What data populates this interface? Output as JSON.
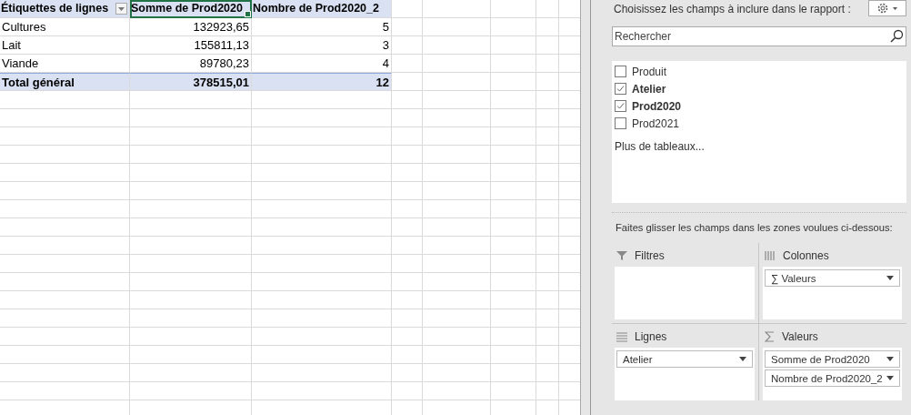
{
  "pivot": {
    "columns": [
      {
        "label": "Étiquettes de lignes",
        "filter": true,
        "selected": false
      },
      {
        "label": "Somme de Prod2020",
        "filter": false,
        "selected": true
      },
      {
        "label": "Nombre de Prod2020_2",
        "filter": false,
        "selected": false
      }
    ],
    "rows": [
      {
        "label": "Cultures",
        "sum": "132923,65",
        "count": "5"
      },
      {
        "label": "Lait",
        "sum": "155811,13",
        "count": "3"
      },
      {
        "label": "Viande",
        "sum": "89780,23",
        "count": "4"
      }
    ],
    "total": {
      "label": "Total général",
      "sum": "378515,01",
      "count": "12"
    }
  },
  "field_pane": {
    "prompt": "Choisissez les champs à inclure dans le rapport :",
    "search": {
      "placeholder": "Rechercher"
    },
    "fields": [
      {
        "label": "Produit",
        "checked": false
      },
      {
        "label": "Atelier",
        "checked": true
      },
      {
        "label": "Prod2020",
        "checked": true
      },
      {
        "label": "Prod2021",
        "checked": false
      }
    ],
    "more_tables": "Plus de tableaux...",
    "areas_prompt": "Faites glisser les champs dans les zones voulues ci-dessous:",
    "areas": [
      {
        "kind": "filters",
        "label": "Filtres"
      },
      {
        "kind": "columns",
        "label": "Colonnes",
        "items": [
          "∑ Valeurs"
        ]
      },
      {
        "kind": "rows",
        "label": "Lignes",
        "items": [
          "Atelier"
        ]
      },
      {
        "kind": "values",
        "label": "Valeurs",
        "items": [
          "Somme de Prod2020",
          "Nombre de Prod2020_2"
        ]
      }
    ]
  }
}
